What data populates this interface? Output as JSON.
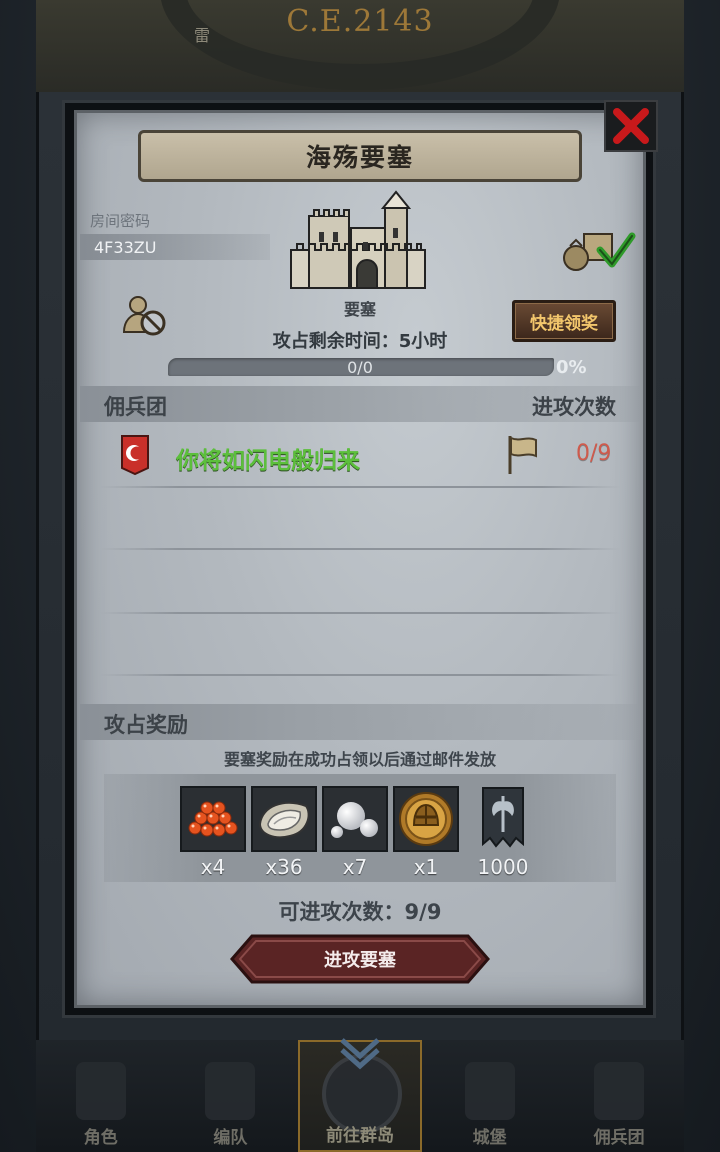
{
  "background": {
    "era_label": "C.E.2143",
    "city_label": "雷"
  },
  "modal": {
    "title": "海殇要塞",
    "room": {
      "label": "房间密码",
      "code": "4F33ZU"
    },
    "fortress": {
      "name": "要塞"
    },
    "remaining_time": "攻占剩余时间：5小时",
    "progress": {
      "text": "0/0",
      "percent_label": "0%",
      "value": 0
    },
    "quick_claim_label": "快捷领奖",
    "mercenary_section": {
      "left_header": "佣兵团",
      "right_header": "进攻次数",
      "rows": [
        {
          "name": "你将如闪电般归来",
          "attacks": "0/9"
        }
      ]
    },
    "reward_section": {
      "header": "攻占奖励",
      "note": "要塞奖励在成功占领以后通过邮件发放",
      "items": [
        {
          "icon": "salmon-roe-icon",
          "qty": "x4"
        },
        {
          "icon": "oyster-icon",
          "qty": "x36"
        },
        {
          "icon": "pearl-icon",
          "qty": "x7"
        },
        {
          "icon": "gold-helmet-medal-icon",
          "qty": "x1"
        },
        {
          "icon": "axe-banner-icon",
          "qty": "1000"
        }
      ]
    },
    "attacks_available": "可进攻次数：9/9",
    "attack_button_label": "进攻要塞"
  },
  "bottom_nav": {
    "tabs": [
      {
        "label": "角色",
        "active": false
      },
      {
        "label": "编队",
        "active": false
      },
      {
        "label": "前往群岛",
        "active": true
      },
      {
        "label": "城堡",
        "active": false
      },
      {
        "label": "佣兵团",
        "active": false
      }
    ]
  },
  "colors": {
    "merc_name_green": "#5cbf3c",
    "attack_count_red": "#cf5a4c",
    "quick_claim_gold": "#f2c66c",
    "close_red": "#c8191b"
  }
}
